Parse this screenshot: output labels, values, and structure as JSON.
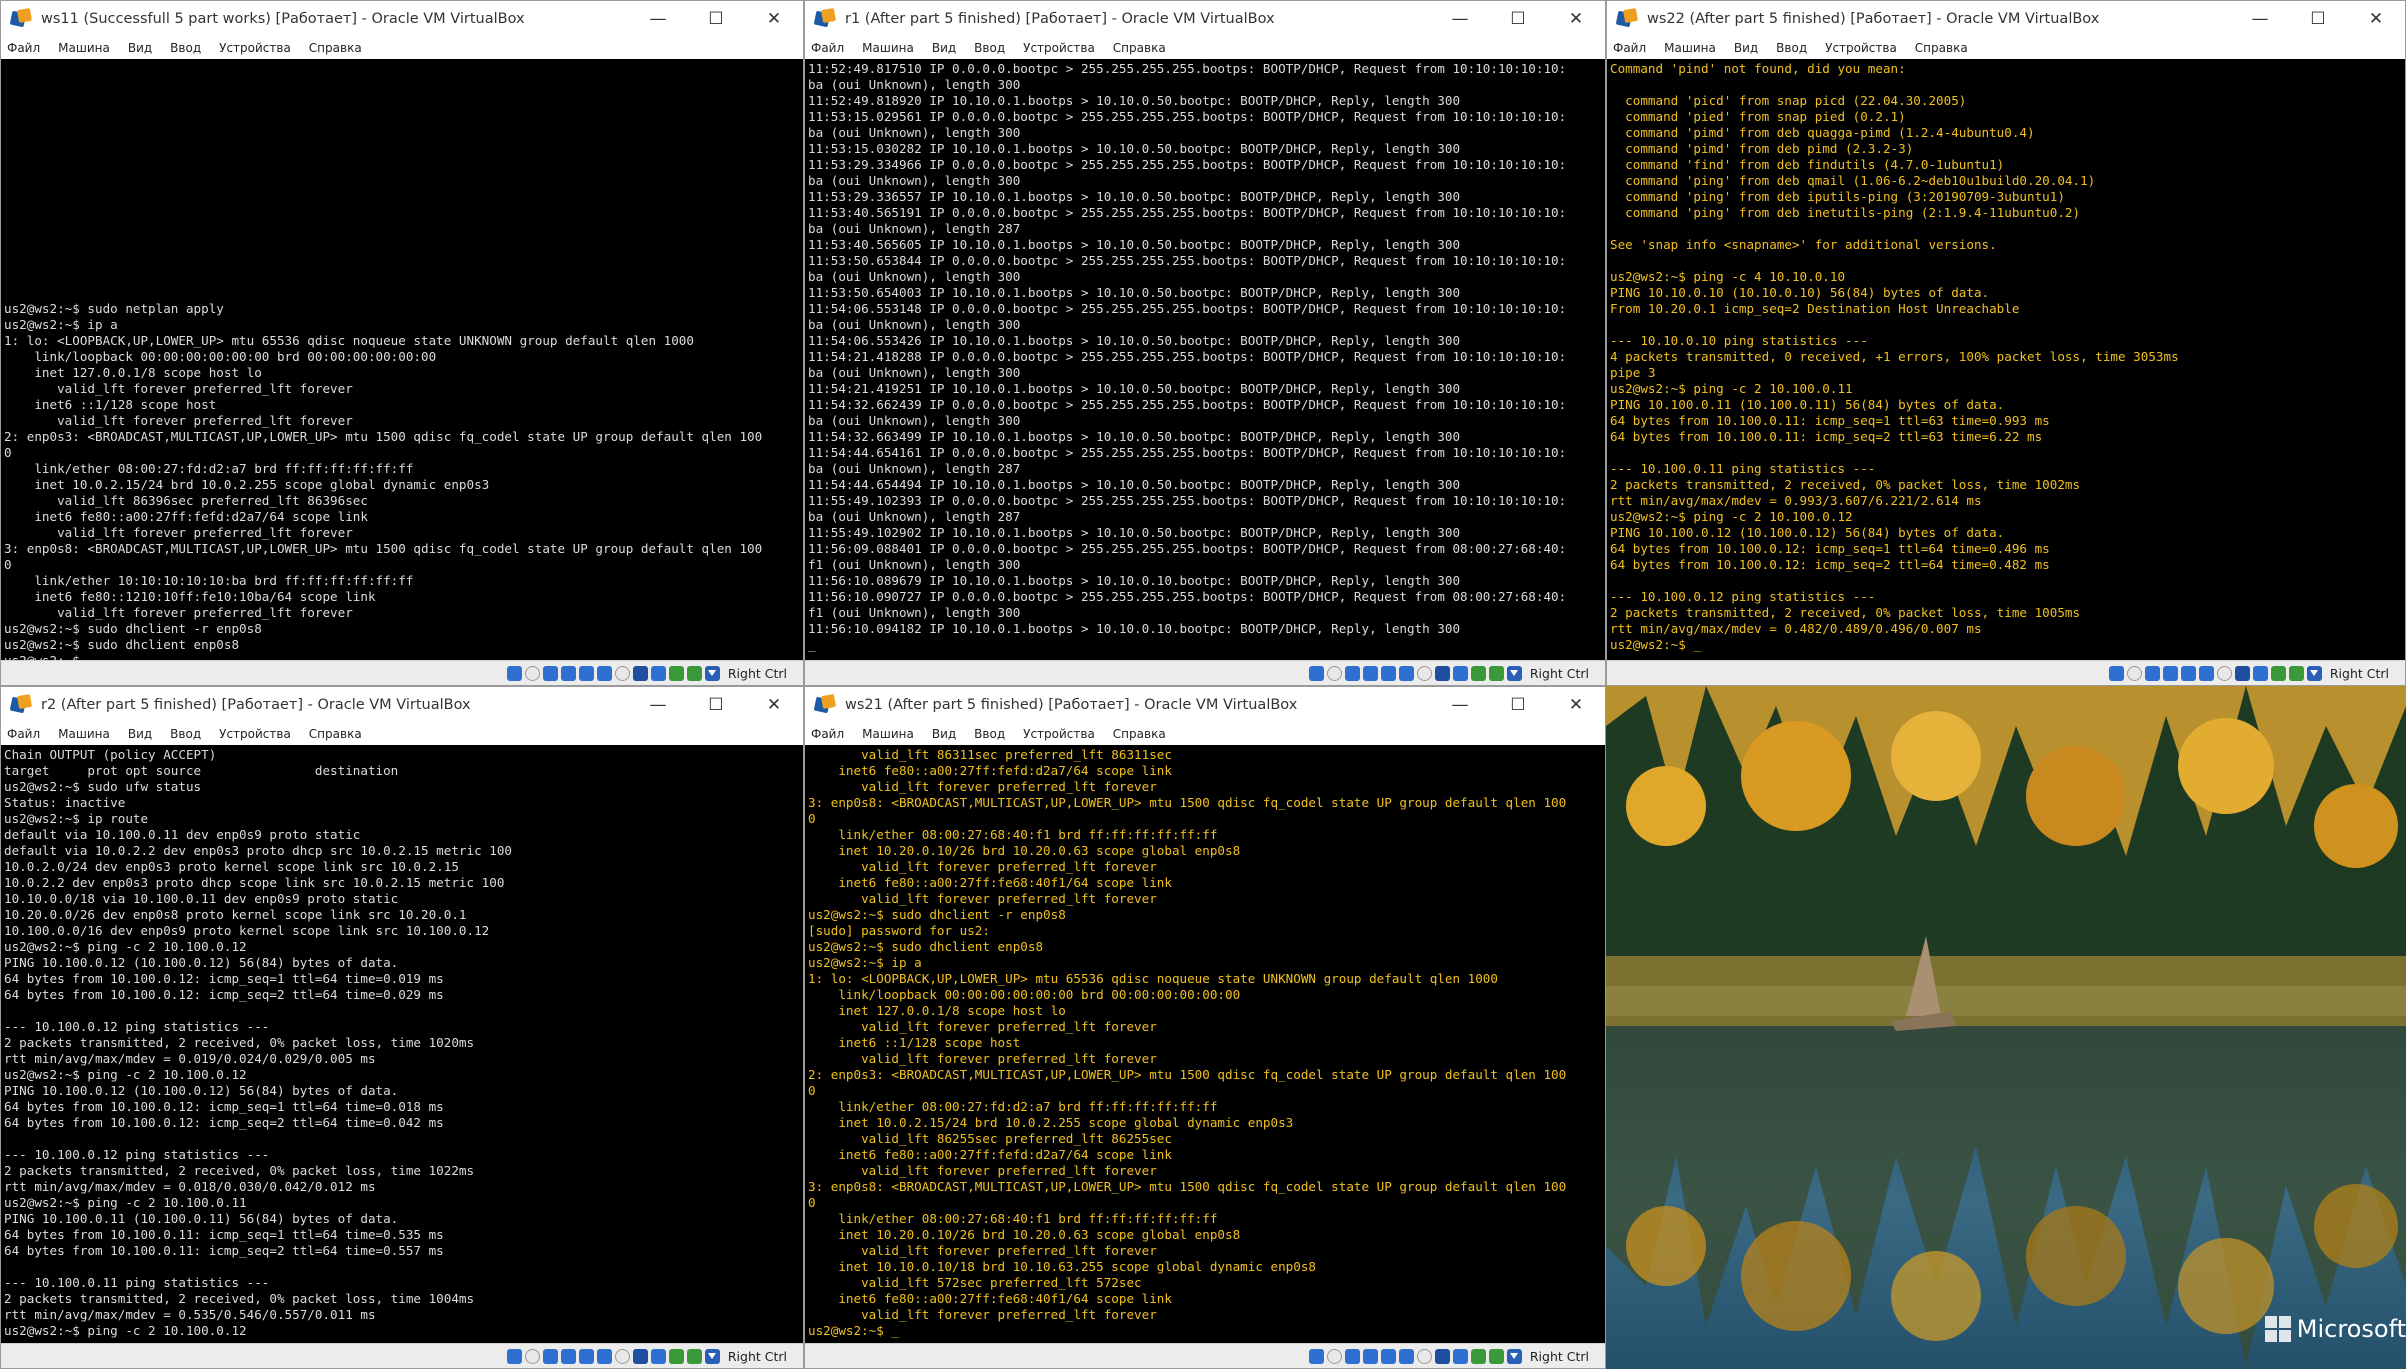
{
  "menu": [
    "Файл",
    "Машина",
    "Вид",
    "Ввод",
    "Устройства",
    "Справка"
  ],
  "window_controls": {
    "minimize": "—",
    "maximize": "☐",
    "close": "✕"
  },
  "status": {
    "host_key": "Right Ctrl"
  },
  "colors": {
    "terminal_white": "#dcdcdc",
    "terminal_yellow": "#f0c020",
    "titlebar": "#ffffff",
    "desktop_brand": "#ffffff"
  },
  "windows": [
    {
      "id": "ws11",
      "title": "ws11 (Successfull 5 part works) [Работает] - Oracle VM VirtualBox",
      "text": "\n\n\n\n\n\n\n\n\n\n\n\n\n\n\nus2@ws2:~$ sudo netplan apply\nus2@ws2:~$ ip a\n1: lo: <LOOPBACK,UP,LOWER_UP> mtu 65536 qdisc noqueue state UNKNOWN group default qlen 1000\n    link/loopback 00:00:00:00:00:00 brd 00:00:00:00:00:00\n    inet 127.0.0.1/8 scope host lo\n       valid_lft forever preferred_lft forever\n    inet6 ::1/128 scope host\n       valid_lft forever preferred_lft forever\n2: enp0s3: <BROADCAST,MULTICAST,UP,LOWER_UP> mtu 1500 qdisc fq_codel state UP group default qlen 100\n0\n    link/ether 08:00:27:fd:d2:a7 brd ff:ff:ff:ff:ff:ff\n    inet 10.0.2.15/24 brd 10.0.2.255 scope global dynamic enp0s3\n       valid_lft 86396sec preferred_lft 86396sec\n    inet6 fe80::a00:27ff:fefd:d2a7/64 scope link\n       valid_lft forever preferred_lft forever\n3: enp0s8: <BROADCAST,MULTICAST,UP,LOWER_UP> mtu 1500 qdisc fq_codel state UP group default qlen 100\n0\n    link/ether 10:10:10:10:10:ba brd ff:ff:ff:ff:ff:ff\n    inet6 fe80::1210:10ff:fe10:10ba/64 scope link\n       valid_lft forever preferred_lft forever\nus2@ws2:~$ sudo dhclient -r enp0s8\nus2@ws2:~$ sudo dhclient enp0s8\nus2@ws2:~$ "
    },
    {
      "id": "r1",
      "title": "r1 (After part 5 finished) [Работает] - Oracle VM VirtualBox",
      "text": "11:52:49.817510 IP 0.0.0.0.bootpc > 255.255.255.255.bootps: BOOTP/DHCP, Request from 10:10:10:10:10:\nba (oui Unknown), length 300\n11:52:49.818920 IP 10.10.0.1.bootps > 10.10.0.50.bootpc: BOOTP/DHCP, Reply, length 300\n11:53:15.029561 IP 0.0.0.0.bootpc > 255.255.255.255.bootps: BOOTP/DHCP, Request from 10:10:10:10:10:\nba (oui Unknown), length 300\n11:53:15.030282 IP 10.10.0.1.bootps > 10.10.0.50.bootpc: BOOTP/DHCP, Reply, length 300\n11:53:29.334966 IP 0.0.0.0.bootpc > 255.255.255.255.bootps: BOOTP/DHCP, Request from 10:10:10:10:10:\nba (oui Unknown), length 300\n11:53:29.336557 IP 10.10.0.1.bootps > 10.10.0.50.bootpc: BOOTP/DHCP, Reply, length 300\n11:53:40.565191 IP 0.0.0.0.bootpc > 255.255.255.255.bootps: BOOTP/DHCP, Request from 10:10:10:10:10:\nba (oui Unknown), length 287\n11:53:40.565605 IP 10.10.0.1.bootps > 10.10.0.50.bootpc: BOOTP/DHCP, Reply, length 300\n11:53:50.653844 IP 0.0.0.0.bootpc > 255.255.255.255.bootps: BOOTP/DHCP, Request from 10:10:10:10:10:\nba (oui Unknown), length 300\n11:53:50.654003 IP 10.10.0.1.bootps > 10.10.0.50.bootpc: BOOTP/DHCP, Reply, length 300\n11:54:06.553148 IP 0.0.0.0.bootpc > 255.255.255.255.bootps: BOOTP/DHCP, Request from 10:10:10:10:10:\nba (oui Unknown), length 300\n11:54:06.553426 IP 10.10.0.1.bootps > 10.10.0.50.bootpc: BOOTP/DHCP, Reply, length 300\n11:54:21.418288 IP 0.0.0.0.bootpc > 255.255.255.255.bootps: BOOTP/DHCP, Request from 10:10:10:10:10:\nba (oui Unknown), length 300\n11:54:21.419251 IP 10.10.0.1.bootps > 10.10.0.50.bootpc: BOOTP/DHCP, Reply, length 300\n11:54:32.662439 IP 0.0.0.0.bootpc > 255.255.255.255.bootps: BOOTP/DHCP, Request from 10:10:10:10:10:\nba (oui Unknown), length 300\n11:54:32.663499 IP 10.10.0.1.bootps > 10.10.0.50.bootpc: BOOTP/DHCP, Reply, length 300\n11:54:44.654161 IP 0.0.0.0.bootpc > 255.255.255.255.bootps: BOOTP/DHCP, Request from 10:10:10:10:10:\nba (oui Unknown), length 287\n11:54:44.654494 IP 10.10.0.1.bootps > 10.10.0.50.bootpc: BOOTP/DHCP, Reply, length 300\n11:55:49.102393 IP 0.0.0.0.bootpc > 255.255.255.255.bootps: BOOTP/DHCP, Request from 10:10:10:10:10:\nba (oui Unknown), length 287\n11:55:49.102902 IP 10.10.0.1.bootps > 10.10.0.50.bootpc: BOOTP/DHCP, Reply, length 300\n11:56:09.088401 IP 0.0.0.0.bootpc > 255.255.255.255.bootps: BOOTP/DHCP, Request from 08:00:27:68:40:\nf1 (oui Unknown), length 300\n11:56:10.089679 IP 10.10.0.1.bootps > 10.10.0.10.bootpc: BOOTP/DHCP, Reply, length 300\n11:56:10.090727 IP 0.0.0.0.bootpc > 255.255.255.255.bootps: BOOTP/DHCP, Request from 08:00:27:68:40:\nf1 (oui Unknown), length 300\n11:56:10.094182 IP 10.10.0.1.bootps > 10.10.0.10.bootpc: BOOTP/DHCP, Reply, length 300\n_"
    },
    {
      "id": "ws22",
      "title": "ws22 (After part 5 finished) [Работает] - Oracle VM VirtualBox",
      "text": "Command 'pind' not found, did you mean:\n\n  command 'picd' from snap picd (22.04.30.2005)\n  command 'pied' from snap pied (0.2.1)\n  command 'pimd' from deb quagga-pimd (1.2.4-4ubuntu0.4)\n  command 'pimd' from deb pimd (2.3.2-3)\n  command 'find' from deb findutils (4.7.0-1ubuntu1)\n  command 'ping' from deb qmail (1.06-6.2~deb10u1build0.20.04.1)\n  command 'ping' from deb iputils-ping (3:20190709-3ubuntu1)\n  command 'ping' from deb inetutils-ping (2:1.9.4-11ubuntu0.2)\n\nSee 'snap info <snapname>' for additional versions.\n\nus2@ws2:~$ ping -c 4 10.10.0.10\nPING 10.10.0.10 (10.10.0.10) 56(84) bytes of data.\nFrom 10.20.0.1 icmp_seq=2 Destination Host Unreachable\n\n--- 10.10.0.10 ping statistics ---\n4 packets transmitted, 0 received, +1 errors, 100% packet loss, time 3053ms\npipe 3\nus2@ws2:~$ ping -c 2 10.100.0.11\nPING 10.100.0.11 (10.100.0.11) 56(84) bytes of data.\n64 bytes from 10.100.0.11: icmp_seq=1 ttl=63 time=0.993 ms\n64 bytes from 10.100.0.11: icmp_seq=2 ttl=63 time=6.22 ms\n\n--- 10.100.0.11 ping statistics ---\n2 packets transmitted, 2 received, 0% packet loss, time 1002ms\nrtt min/avg/max/mdev = 0.993/3.607/6.221/2.614 ms\nus2@ws2:~$ ping -c 2 10.100.0.12\nPING 10.100.0.12 (10.100.0.12) 56(84) bytes of data.\n64 bytes from 10.100.0.12: icmp_seq=1 ttl=64 time=0.496 ms\n64 bytes from 10.100.0.12: icmp_seq=2 ttl=64 time=0.482 ms\n\n--- 10.100.0.12 ping statistics ---\n2 packets transmitted, 2 received, 0% packet loss, time 1005ms\nrtt min/avg/max/mdev = 0.482/0.489/0.496/0.007 ms\nus2@ws2:~$ _"
    },
    {
      "id": "r2",
      "title": "r2 (After part 5 finished) [Работает] - Oracle VM VirtualBox",
      "text": "Chain OUTPUT (policy ACCEPT)\ntarget     prot opt source               destination\nus2@ws2:~$ sudo ufw status\nStatus: inactive\nus2@ws2:~$ ip route\ndefault via 10.100.0.11 dev enp0s9 proto static\ndefault via 10.0.2.2 dev enp0s3 proto dhcp src 10.0.2.15 metric 100\n10.0.2.0/24 dev enp0s3 proto kernel scope link src 10.0.2.15\n10.0.2.2 dev enp0s3 proto dhcp scope link src 10.0.2.15 metric 100\n10.10.0.0/18 via 10.100.0.11 dev enp0s9 proto static\n10.20.0.0/26 dev enp0s8 proto kernel scope link src 10.20.0.1\n10.100.0.0/16 dev enp0s9 proto kernel scope link src 10.100.0.12\nus2@ws2:~$ ping -c 2 10.100.0.12\nPING 10.100.0.12 (10.100.0.12) 56(84) bytes of data.\n64 bytes from 10.100.0.12: icmp_seq=1 ttl=64 time=0.019 ms\n64 bytes from 10.100.0.12: icmp_seq=2 ttl=64 time=0.029 ms\n\n--- 10.100.0.12 ping statistics ---\n2 packets transmitted, 2 received, 0% packet loss, time 1020ms\nrtt min/avg/max/mdev = 0.019/0.024/0.029/0.005 ms\nus2@ws2:~$ ping -c 2 10.100.0.12\nPING 10.100.0.12 (10.100.0.12) 56(84) bytes of data.\n64 bytes from 10.100.0.12: icmp_seq=1 ttl=64 time=0.018 ms\n64 bytes from 10.100.0.12: icmp_seq=2 ttl=64 time=0.042 ms\n\n--- 10.100.0.12 ping statistics ---\n2 packets transmitted, 2 received, 0% packet loss, time 1022ms\nrtt min/avg/max/mdev = 0.018/0.030/0.042/0.012 ms\nus2@ws2:~$ ping -c 2 10.100.0.11\nPING 10.100.0.11 (10.100.0.11) 56(84) bytes of data.\n64 bytes from 10.100.0.11: icmp_seq=1 ttl=64 time=0.535 ms\n64 bytes from 10.100.0.11: icmp_seq=2 ttl=64 time=0.557 ms\n\n--- 10.100.0.11 ping statistics ---\n2 packets transmitted, 2 received, 0% packet loss, time 1004ms\nrtt min/avg/max/mdev = 0.535/0.546/0.557/0.011 ms\nus2@ws2:~$ ping -c 2 10.100.0.12"
    },
    {
      "id": "ws21",
      "title": "ws21 (After part 5 finished) [Работает] - Oracle VM VirtualBox",
      "text": "       valid_lft 86311sec preferred_lft 86311sec\n    inet6 fe80::a00:27ff:fefd:d2a7/64 scope link\n       valid_lft forever preferred_lft forever\n3: enp0s8: <BROADCAST,MULTICAST,UP,LOWER_UP> mtu 1500 qdisc fq_codel state UP group default qlen 100\n0\n    link/ether 08:00:27:68:40:f1 brd ff:ff:ff:ff:ff:ff\n    inet 10.20.0.10/26 brd 10.20.0.63 scope global enp0s8\n       valid_lft forever preferred_lft forever\n    inet6 fe80::a00:27ff:fe68:40f1/64 scope link\n       valid_lft forever preferred_lft forever\nus2@ws2:~$ sudo dhclient -r enp0s8\n[sudo] password for us2:\nus2@ws2:~$ sudo dhclient enp0s8\nus2@ws2:~$ ip a\n1: lo: <LOOPBACK,UP,LOWER_UP> mtu 65536 qdisc noqueue state UNKNOWN group default qlen 1000\n    link/loopback 00:00:00:00:00:00 brd 00:00:00:00:00:00\n    inet 127.0.0.1/8 scope host lo\n       valid_lft forever preferred_lft forever\n    inet6 ::1/128 scope host\n       valid_lft forever preferred_lft forever\n2: enp0s3: <BROADCAST,MULTICAST,UP,LOWER_UP> mtu 1500 qdisc fq_codel state UP group default qlen 100\n0\n    link/ether 08:00:27:fd:d2:a7 brd ff:ff:ff:ff:ff:ff\n    inet 10.0.2.15/24 brd 10.0.2.255 scope global dynamic enp0s3\n       valid_lft 86255sec preferred_lft 86255sec\n    inet6 fe80::a00:27ff:fefd:d2a7/64 scope link\n       valid_lft forever preferred_lft forever\n3: enp0s8: <BROADCAST,MULTICAST,UP,LOWER_UP> mtu 1500 qdisc fq_codel state UP group default qlen 100\n0\n    link/ether 08:00:27:68:40:f1 brd ff:ff:ff:ff:ff:ff\n    inet 10.20.0.10/26 brd 10.20.0.63 scope global enp0s8\n       valid_lft forever preferred_lft forever\n    inet 10.10.0.10/18 brd 10.10.63.255 scope global dynamic enp0s8\n       valid_lft 572sec preferred_lft 572sec\n    inet6 fe80::a00:27ff:fe68:40f1/64 scope link\n       valid_lft forever preferred_lft forever\nus2@ws2:~$ _"
    }
  ],
  "desktop": {
    "brand_text": "Microsoft"
  }
}
